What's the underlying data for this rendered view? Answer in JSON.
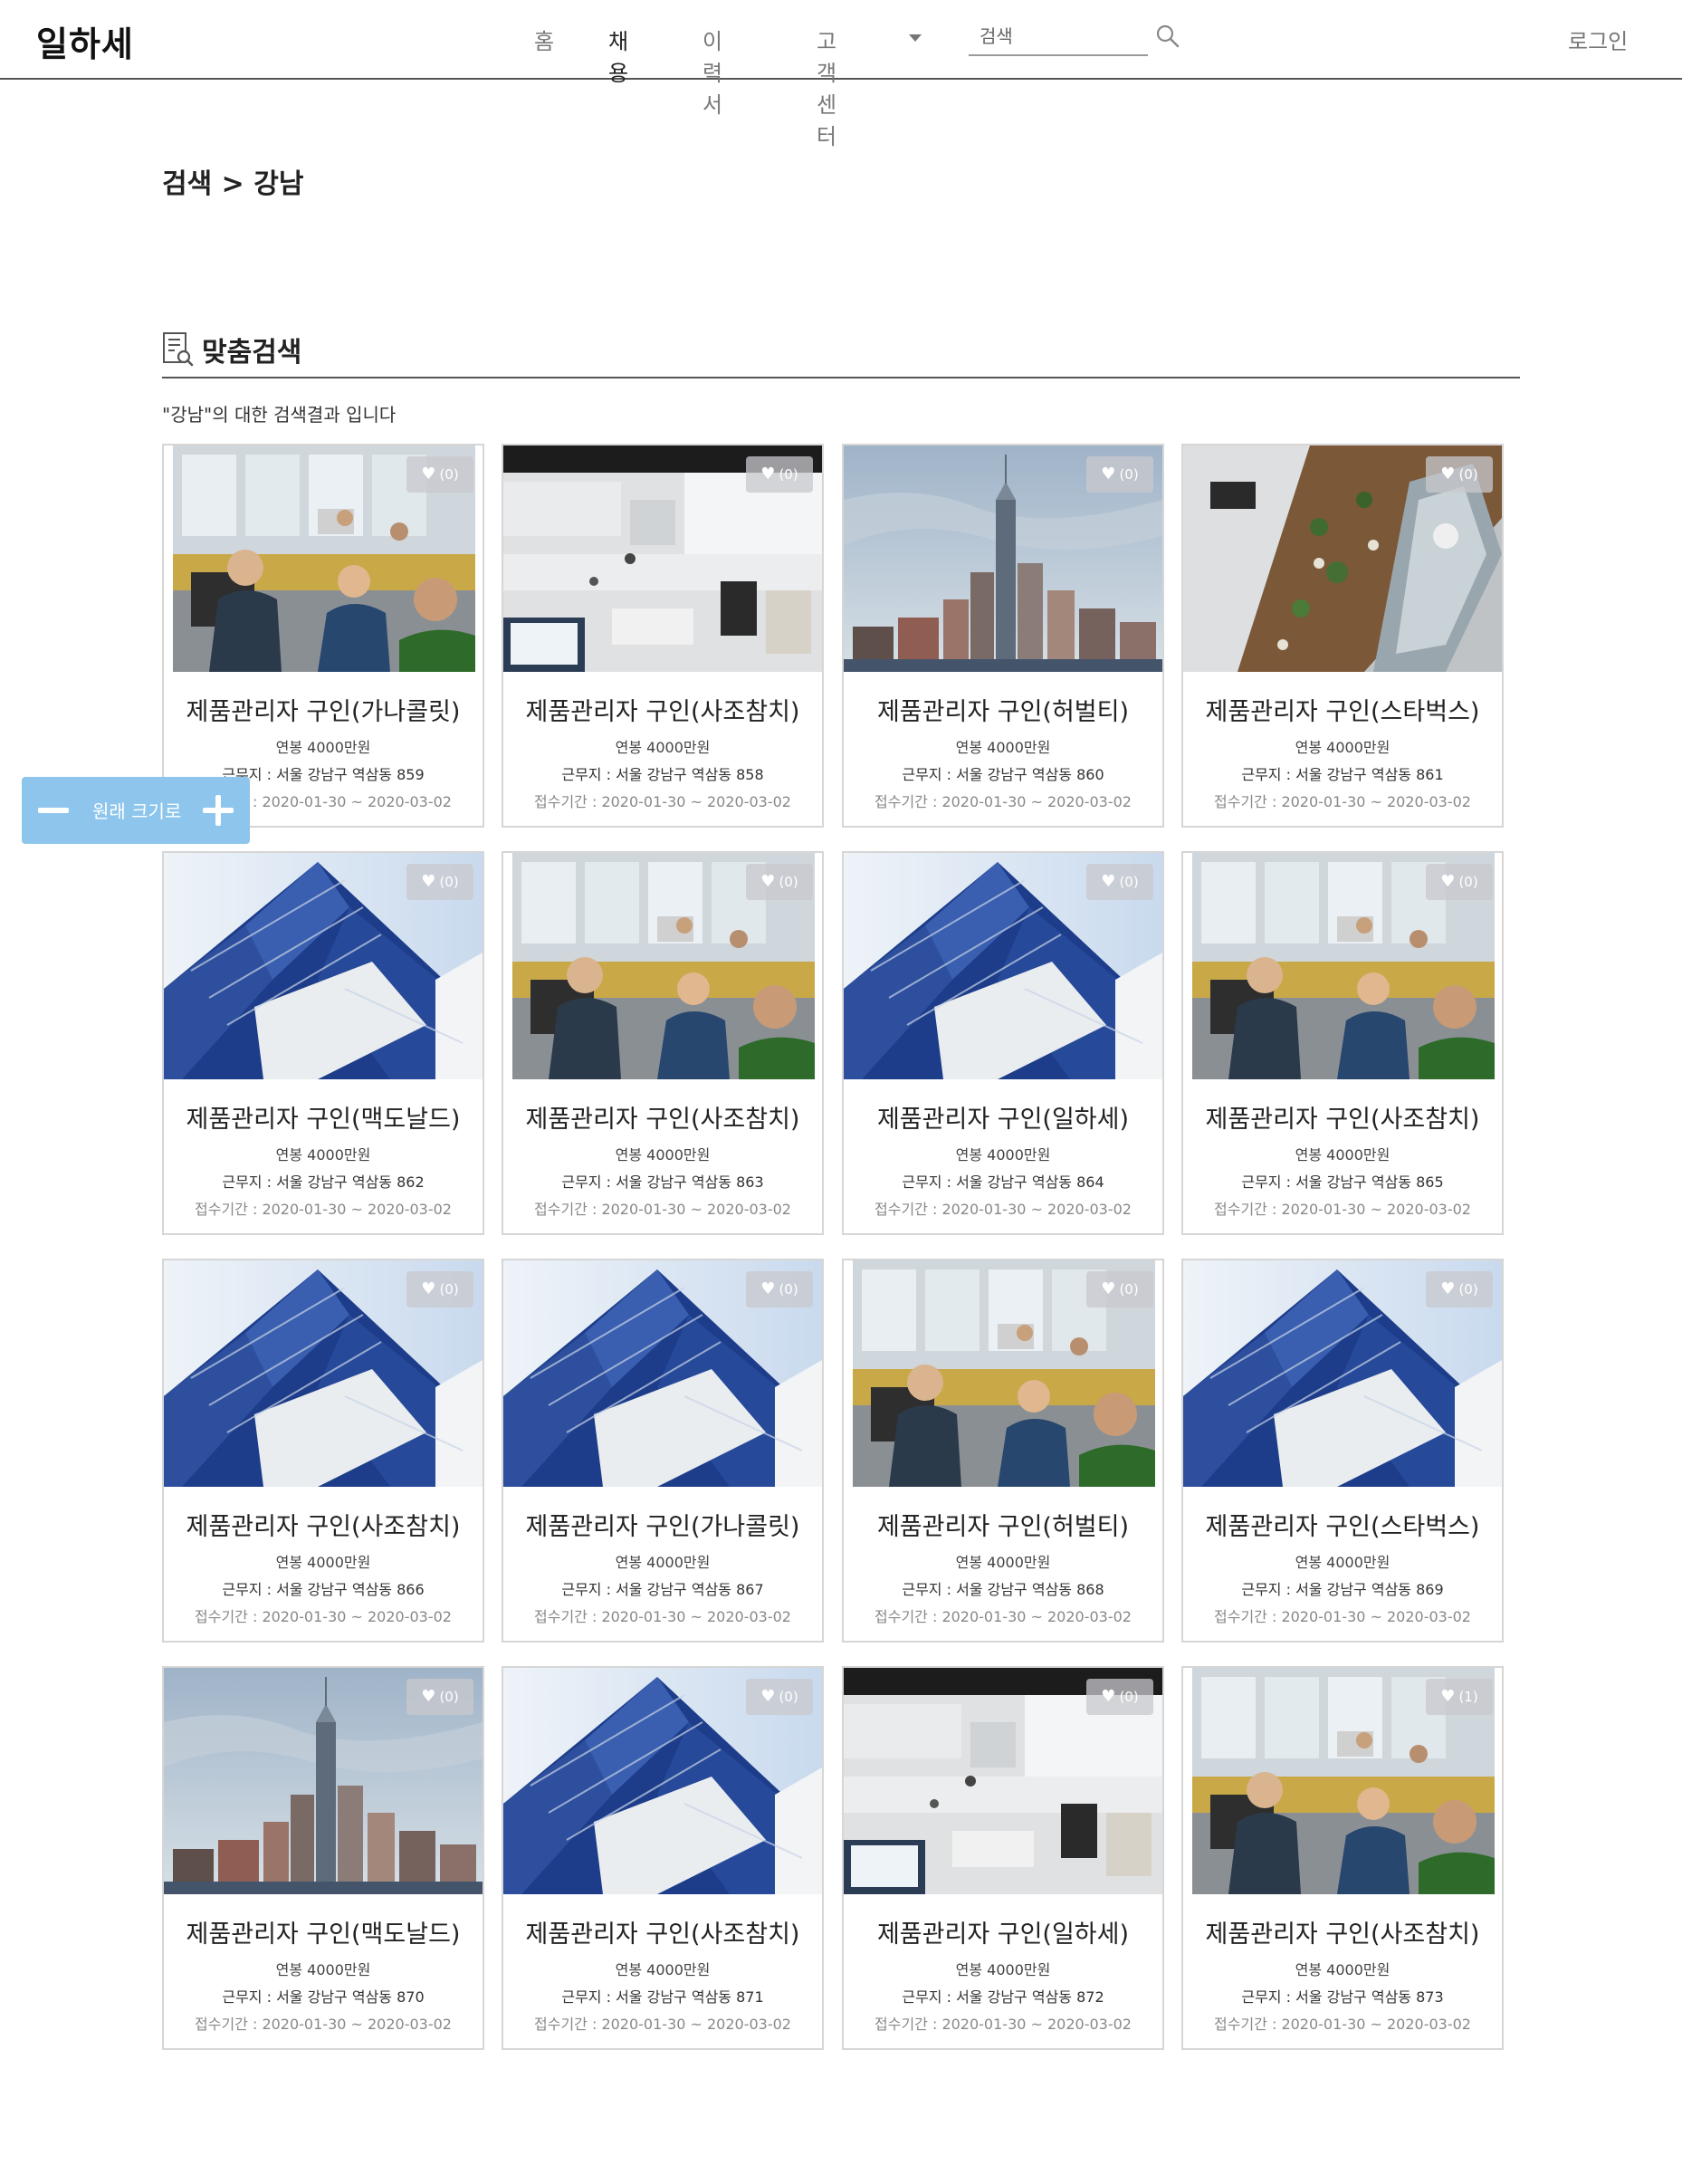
{
  "header": {
    "logo": "일하세",
    "nav": {
      "home": "홈",
      "jobs": "채용",
      "resume": "이력서",
      "help": "고객센터"
    },
    "search_placeholder": "검색",
    "login": "로그인"
  },
  "breadcrumb": "검색 > 강남",
  "section": {
    "title": "맞춤검색",
    "result_note": "\"강남\"의 대한 검색결과 입니다"
  },
  "zoom": {
    "label": "원래 크기로"
  },
  "cards": [
    {
      "title": "제품관리자 구인(가나콜릿)",
      "salary": "연봉 4000만원",
      "location": "근무지 : 서울 강남구 역삼동 859",
      "period": "접수기간 : 2020-01-30 ~ 2020-03-02",
      "likes": "(0)",
      "image": "office-meeting"
    },
    {
      "title": "제품관리자 구인(사조참치)",
      "salary": "연봉 4000만원",
      "location": "근무지 : 서울 강남구 역삼동 858",
      "period": "접수기간 : 2020-01-30 ~ 2020-03-02",
      "likes": "(0)",
      "image": "open-office"
    },
    {
      "title": "제품관리자 구인(허벌티)",
      "salary": "연봉 4000만원",
      "location": "근무지 : 서울 강남구 역삼동 860",
      "period": "접수기간 : 2020-01-30 ~ 2020-03-02",
      "likes": "(0)",
      "image": "city-skyline"
    },
    {
      "title": "제품관리자 구인(스타벅스)",
      "salary": "연봉 4000만원",
      "location": "근무지 : 서울 강남구 역삼동 861",
      "period": "접수기간 : 2020-01-30 ~ 2020-03-02",
      "likes": "(0)",
      "image": "atrium-aerial"
    },
    {
      "title": "제품관리자 구인(맥도날드)",
      "salary": "연봉 4000만원",
      "location": "근무지 : 서울 강남구 역삼동 862",
      "period": "접수기간 : 2020-01-30 ~ 2020-03-02",
      "likes": "(0)",
      "image": "glass-building"
    },
    {
      "title": "제품관리자 구인(사조참치)",
      "salary": "연봉 4000만원",
      "location": "근무지 : 서울 강남구 역삼동 863",
      "period": "접수기간 : 2020-01-30 ~ 2020-03-02",
      "likes": "(0)",
      "image": "office-meeting"
    },
    {
      "title": "제품관리자 구인(일하세)",
      "salary": "연봉 4000만원",
      "location": "근무지 : 서울 강남구 역삼동 864",
      "period": "접수기간 : 2020-01-30 ~ 2020-03-02",
      "likes": "(0)",
      "image": "glass-building"
    },
    {
      "title": "제품관리자 구인(사조참치)",
      "salary": "연봉 4000만원",
      "location": "근무지 : 서울 강남구 역삼동 865",
      "period": "접수기간 : 2020-01-30 ~ 2020-03-02",
      "likes": "(0)",
      "image": "office-meeting"
    },
    {
      "title": "제품관리자 구인(사조참치)",
      "salary": "연봉 4000만원",
      "location": "근무지 : 서울 강남구 역삼동 866",
      "period": "접수기간 : 2020-01-30 ~ 2020-03-02",
      "likes": "(0)",
      "image": "glass-building"
    },
    {
      "title": "제품관리자 구인(가나콜릿)",
      "salary": "연봉 4000만원",
      "location": "근무지 : 서울 강남구 역삼동 867",
      "period": "접수기간 : 2020-01-30 ~ 2020-03-02",
      "likes": "(0)",
      "image": "glass-building"
    },
    {
      "title": "제품관리자 구인(허벌티)",
      "salary": "연봉 4000만원",
      "location": "근무지 : 서울 강남구 역삼동 868",
      "period": "접수기간 : 2020-01-30 ~ 2020-03-02",
      "likes": "(0)",
      "image": "office-meeting"
    },
    {
      "title": "제품관리자 구인(스타벅스)",
      "salary": "연봉 4000만원",
      "location": "근무지 : 서울 강남구 역삼동 869",
      "period": "접수기간 : 2020-01-30 ~ 2020-03-02",
      "likes": "(0)",
      "image": "glass-building"
    },
    {
      "title": "제품관리자 구인(맥도날드)",
      "salary": "연봉 4000만원",
      "location": "근무지 : 서울 강남구 역삼동 870",
      "period": "접수기간 : 2020-01-30 ~ 2020-03-02",
      "likes": "(0)",
      "image": "city-skyline"
    },
    {
      "title": "제품관리자 구인(사조참치)",
      "salary": "연봉 4000만원",
      "location": "근무지 : 서울 강남구 역삼동 871",
      "period": "접수기간 : 2020-01-30 ~ 2020-03-02",
      "likes": "(0)",
      "image": "glass-building"
    },
    {
      "title": "제품관리자 구인(일하세)",
      "salary": "연봉 4000만원",
      "location": "근무지 : 서울 강남구 역삼동 872",
      "period": "접수기간 : 2020-01-30 ~ 2020-03-02",
      "likes": "(0)",
      "image": "open-office"
    },
    {
      "title": "제품관리자 구인(사조참치)",
      "salary": "연봉 4000만원",
      "location": "근무지 : 서울 강남구 역삼동 873",
      "period": "접수기간 : 2020-01-30 ~ 2020-03-02",
      "likes": "(1)",
      "image": "office-meeting"
    }
  ]
}
